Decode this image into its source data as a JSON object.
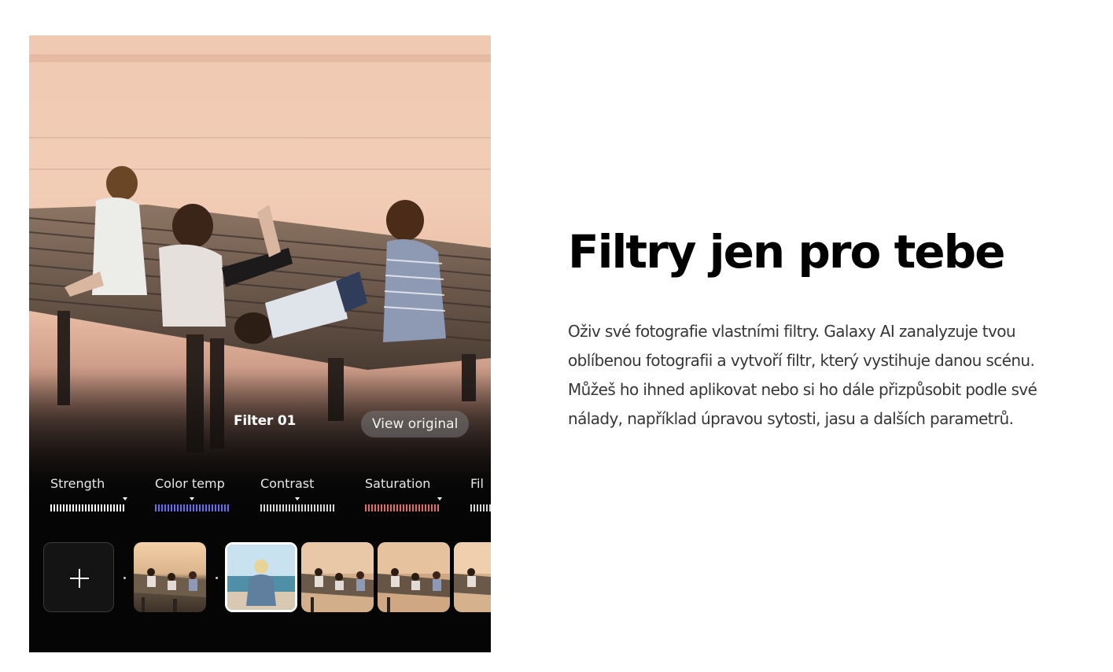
{
  "section": {
    "headline": "Filtry jen pro tebe",
    "description": "Oživ své fotografie vlastními filtry. Galaxy AI zanalyzuje tvou oblíbenou fotografii a vytvoří filtr, který vystihuje danou scénu. Můžeš ho ihned aplikovat nebo si ho dále přizpůsobit podle své nálady, například úpravou sytosti, jasu a dalších parametrů."
  },
  "editor": {
    "filter_name": "Filter 01",
    "view_original_label": "View original",
    "sliders": [
      {
        "label": "Strength",
        "color": "#ffffff"
      },
      {
        "label": "Color temp",
        "color": "#6a6cf0"
      },
      {
        "label": "Contrast",
        "color": "#d8d8d8"
      },
      {
        "label": "Saturation",
        "color": "#e36a6a"
      },
      {
        "label": "Fil",
        "color": "#d8d8d8"
      }
    ],
    "add_filter_icon": "plus-icon",
    "thumbnails": [
      {
        "name": "pier-filter",
        "selected": false
      },
      {
        "name": "beach-photo",
        "selected": true
      },
      {
        "name": "pier-filter",
        "selected": false
      },
      {
        "name": "pier-filter",
        "selected": false
      },
      {
        "name": "pier-filter",
        "selected": false
      }
    ]
  },
  "colors": {
    "headline": "#000000",
    "body_text": "#363636",
    "editor_bg": "#050505"
  }
}
